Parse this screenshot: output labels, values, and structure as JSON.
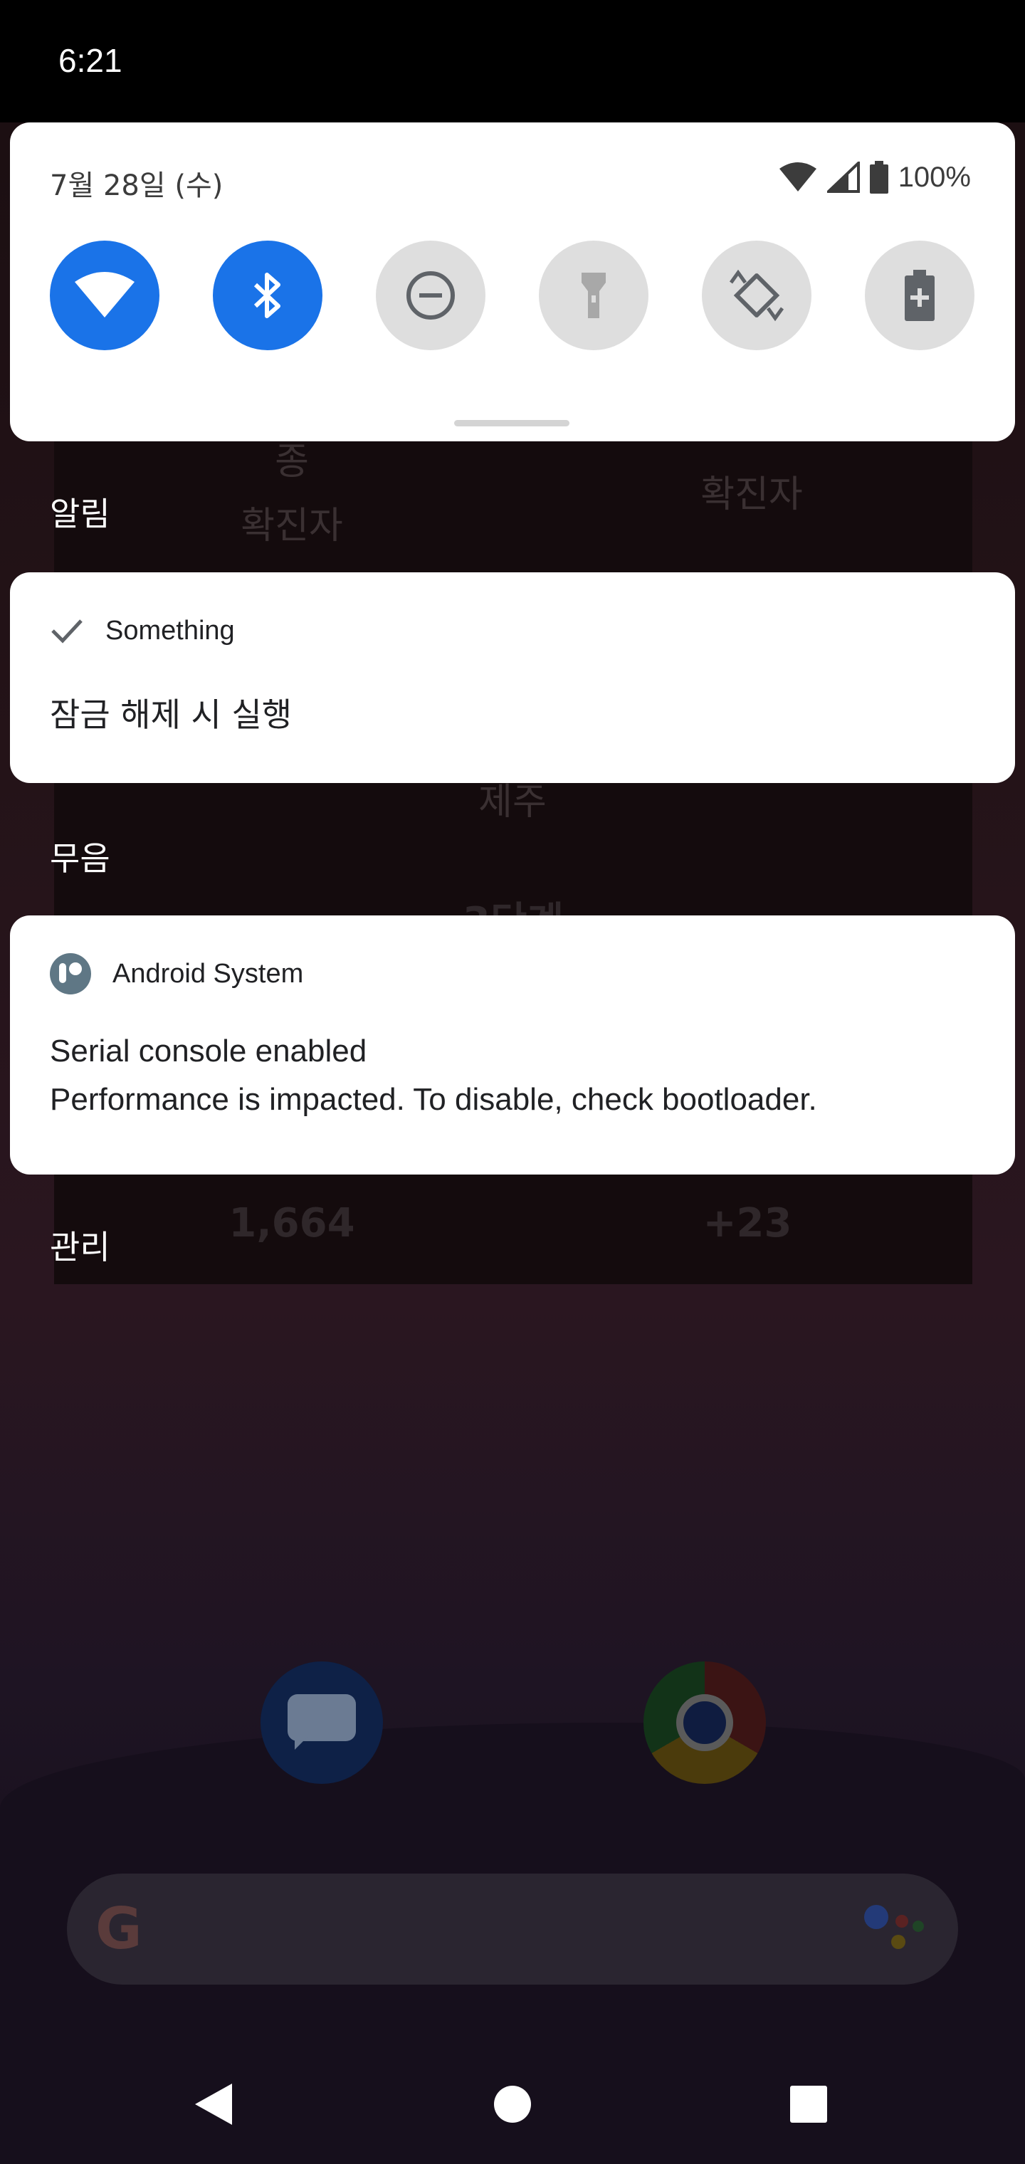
{
  "status_bar": {
    "time": "6:21"
  },
  "quick_settings": {
    "date": "7월 28일 (수)",
    "battery_percent": "100%",
    "tiles": [
      {
        "icon": "wifi-icon",
        "state": "on"
      },
      {
        "icon": "bluetooth-icon",
        "state": "on"
      },
      {
        "icon": "do-not-disturb-icon",
        "state": "off"
      },
      {
        "icon": "flashlight-icon",
        "state": "off"
      },
      {
        "icon": "auto-rotate-icon",
        "state": "off"
      },
      {
        "icon": "battery-saver-icon",
        "state": "off"
      }
    ],
    "accent_color": "#1a73e8"
  },
  "shade": {
    "section_alerting": "알림",
    "section_silent": "무음",
    "section_manage": "관리",
    "notification_1": {
      "app": "Something",
      "icon": "check-icon",
      "title": "잠금 해제 시 실행"
    },
    "notification_2": {
      "app": "Android System",
      "icon": "android-system-icon",
      "title": "Serial console enabled",
      "text": "Performance is impacted. To disable, check bootloader."
    }
  },
  "background": {
    "widget_labels": [
      "종",
      "확진자",
      "확진자",
      "제주",
      "3단계"
    ],
    "widget_values": [
      "1,664",
      "+23"
    ],
    "dock_icons": [
      "messages-icon",
      "chrome-icon"
    ],
    "search_bar_icons": [
      "google-g-icon",
      "assistant-icon"
    ]
  },
  "nav": {
    "buttons": [
      "back-icon",
      "home-icon",
      "recents-icon"
    ]
  }
}
